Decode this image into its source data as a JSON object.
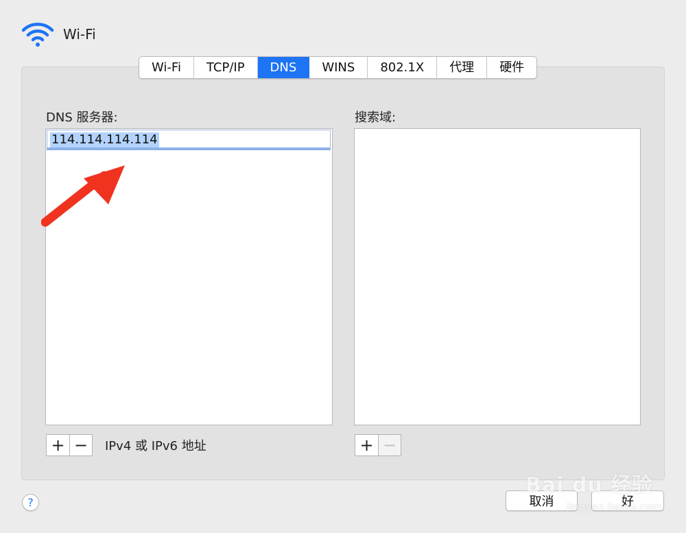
{
  "header": {
    "title": "Wi-Fi",
    "icon": "wifi-icon"
  },
  "tabs": [
    {
      "label": "Wi-Fi",
      "selected": false
    },
    {
      "label": "TCP/IP",
      "selected": false
    },
    {
      "label": "DNS",
      "selected": true
    },
    {
      "label": "WINS",
      "selected": false
    },
    {
      "label": "802.1X",
      "selected": false
    },
    {
      "label": "代理",
      "selected": false
    },
    {
      "label": "硬件",
      "selected": false
    }
  ],
  "dns": {
    "label": "DNS 服务器:",
    "servers": [
      "114.114.114.114"
    ],
    "hint": "IPv4 或 IPv6 地址",
    "add_label": "+",
    "remove_label": "−"
  },
  "search": {
    "label": "搜索域:",
    "domains": [],
    "add_label": "+",
    "remove_label": "−"
  },
  "footer": {
    "help_label": "?",
    "cancel_label": "取消",
    "ok_label": "好"
  },
  "watermark": {
    "main": "Bai du 经验",
    "sub": "jingyan.baidu.com"
  },
  "colors": {
    "accent": "#1d74f5",
    "selection": "#b3d3fc",
    "annotation_arrow": "#f0331f"
  }
}
